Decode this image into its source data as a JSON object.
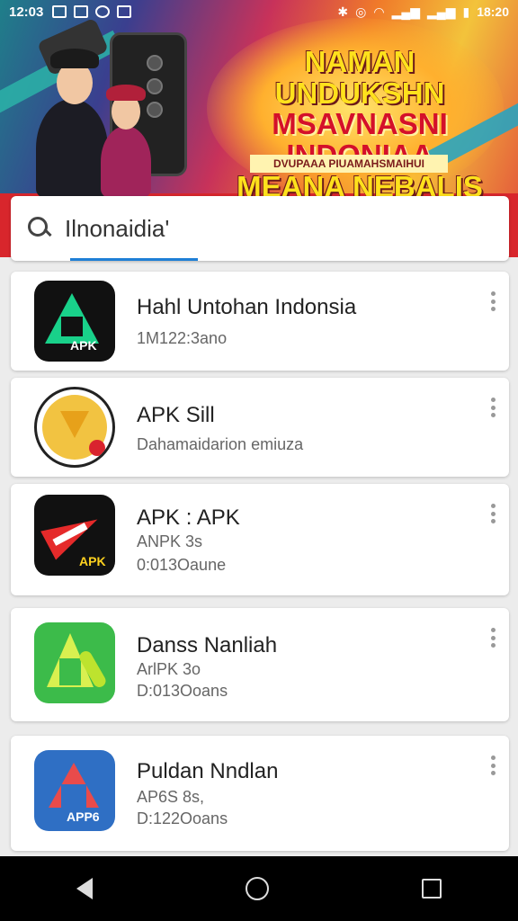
{
  "status_bar": {
    "time_left": "12:03",
    "time_right": "18:20"
  },
  "banner": {
    "headline_1": "NAMAN UNDUKSHN",
    "headline_2": "MSAVNASNI INDONIAA",
    "headline_3": "MEANA NEBALIS",
    "subhead": "DVUPAAA PIUAMAHSMAIHUI"
  },
  "search": {
    "value": "Ilnonaidia'"
  },
  "apps": [
    {
      "title": "Hahl Untohan Indonsia",
      "line1": "1M122:3ano",
      "line2": "",
      "icon_tag": "APK",
      "icon_color": "#19d18a"
    },
    {
      "title": "APK Sill",
      "line1": "Dahamaidarion emiuza",
      "line2": "",
      "icon_tag": "",
      "icon_color": "#f2c341"
    },
    {
      "title": "APK : APK",
      "line1": "ANPK 3s",
      "line2": "0:013Oaune",
      "icon_tag": "APK",
      "icon_color": "#e52a2a"
    },
    {
      "title": "Danss Nanliah",
      "line1": "ArlPK 3o",
      "line2": "D:013Ooans",
      "icon_tag": "",
      "icon_color": "#3cbb4a"
    },
    {
      "title": "Puldan Nndlan",
      "line1": "AP6S 8s,",
      "line2": "D:122Ooans",
      "icon_tag": "APP6",
      "icon_color": "#2f6fc4"
    }
  ],
  "icons": {
    "search": "search-icon",
    "overflow": "more-vert-icon",
    "nav_back": "back-icon",
    "nav_home": "home-icon",
    "nav_recent": "recent-apps-icon"
  }
}
